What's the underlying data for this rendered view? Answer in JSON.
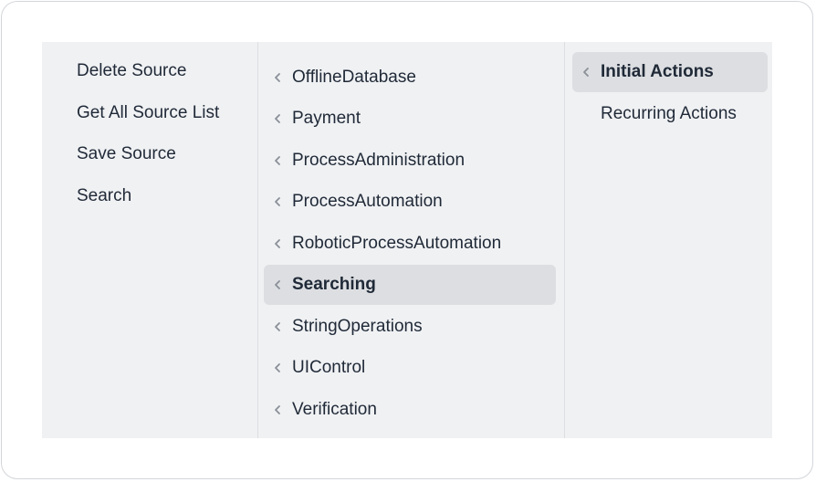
{
  "column1": {
    "items": [
      {
        "label": "Delete Source"
      },
      {
        "label": "Get All Source List"
      },
      {
        "label": "Save Source"
      },
      {
        "label": "Search"
      }
    ]
  },
  "column2": {
    "items": [
      {
        "label": "OfflineDatabase"
      },
      {
        "label": "Payment"
      },
      {
        "label": "ProcessAdministration"
      },
      {
        "label": "ProcessAutomation"
      },
      {
        "label": "RoboticProcessAutomation"
      },
      {
        "label": "Searching",
        "selected": true
      },
      {
        "label": "StringOperations"
      },
      {
        "label": "UIControl"
      },
      {
        "label": "Verification"
      }
    ]
  },
  "column3": {
    "items": [
      {
        "label": "Initial Actions",
        "selected": true
      },
      {
        "label": "Recurring Actions"
      }
    ]
  },
  "colors": {
    "panel_bg": "#f0f1f3",
    "selected_bg": "#dcdee1",
    "text": "#1f2937",
    "chevron": "#8a8f98"
  }
}
